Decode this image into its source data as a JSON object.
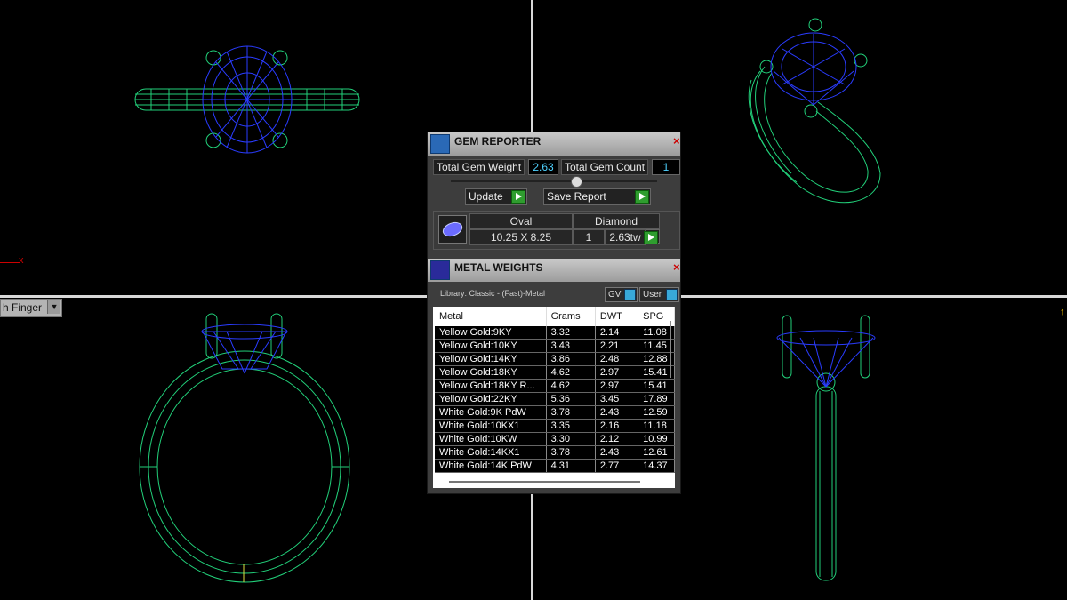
{
  "viewport": {
    "label": "h Finger"
  },
  "gem_reporter": {
    "title": "GEM REPORTER",
    "total_gem_weight_label": "Total Gem Weight",
    "total_gem_weight": "2.63",
    "total_gem_count_label": "Total Gem Count",
    "total_gem_count": "1",
    "update_label": "Update",
    "save_report_label": "Save Report",
    "gem": {
      "shape": "Oval",
      "type": "Diamond",
      "size": "10.25 X 8.25",
      "count": "1",
      "weight": "2.63tw"
    }
  },
  "metal_weights": {
    "title": "METAL WEIGHTS",
    "library": "Library: Classic - (Fast)-Metal",
    "gv_label": "GV",
    "user_label": "User",
    "columns": [
      "Metal",
      "Grams",
      "DWT",
      "SPG"
    ],
    "rows": [
      [
        "Yellow Gold:9KY",
        "3.32",
        "2.14",
        "11.08"
      ],
      [
        "Yellow Gold:10KY",
        "3.43",
        "2.21",
        "11.45"
      ],
      [
        "Yellow Gold:14KY",
        "3.86",
        "2.48",
        "12.88"
      ],
      [
        "Yellow Gold:18KY",
        "4.62",
        "2.97",
        "15.41"
      ],
      [
        "Yellow Gold:18KY R...",
        "4.62",
        "2.97",
        "15.41"
      ],
      [
        "Yellow Gold:22KY",
        "5.36",
        "3.45",
        "17.89"
      ],
      [
        "White Gold:9K PdW",
        "3.78",
        "2.43",
        "12.59"
      ],
      [
        "White Gold:10KX1",
        "3.35",
        "2.16",
        "11.18"
      ],
      [
        "White Gold:10KW",
        "3.30",
        "2.12",
        "10.99"
      ],
      [
        "White Gold:14KX1",
        "3.78",
        "2.43",
        "12.61"
      ],
      [
        "White Gold:14K PdW",
        "4.31",
        "2.77",
        "14.37"
      ]
    ]
  },
  "colors": {
    "gem_wire": "#2a3cff",
    "metal_wire": "#22d07a",
    "value_text": "#4fd2ff"
  }
}
